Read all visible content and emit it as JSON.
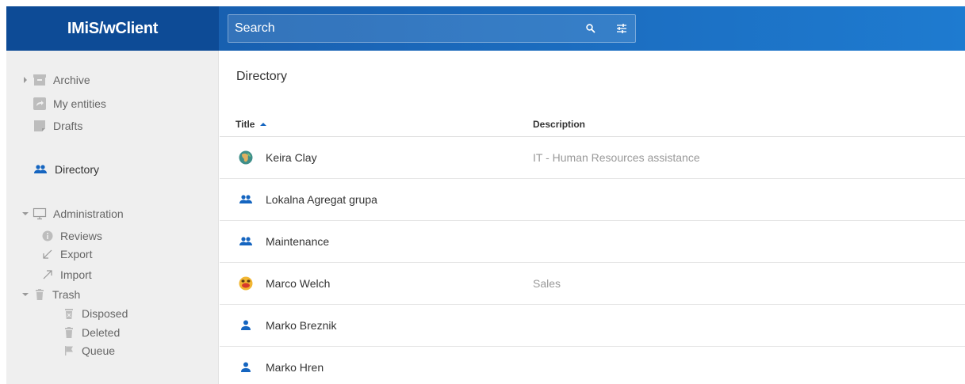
{
  "app": {
    "title": "IMiS/wClient"
  },
  "search": {
    "placeholder": "Search"
  },
  "sidebar": {
    "archive": "Archive",
    "my_entities": "My entities",
    "drafts": "Drafts",
    "directory": "Directory",
    "administration": "Administration",
    "reviews": "Reviews",
    "export": "Export",
    "import": "Import",
    "trash": "Trash",
    "disposed": "Disposed",
    "deleted": "Deleted",
    "queue": "Queue"
  },
  "main": {
    "title": "Directory",
    "columns": {
      "title": "Title",
      "description": "Description"
    },
    "rows": [
      {
        "title": "Keira Clay",
        "description": "IT - Human Resources assistance",
        "icon": "avatar-globe-icon"
      },
      {
        "title": "Lokalna Agregat grupa",
        "description": "",
        "icon": "group-icon"
      },
      {
        "title": "Maintenance",
        "description": "",
        "icon": "group-icon"
      },
      {
        "title": "Marco Welch",
        "description": "Sales",
        "icon": "avatar-emoji-icon"
      },
      {
        "title": "Marko Breznik",
        "description": "",
        "icon": "person-icon"
      },
      {
        "title": "Marko Hren",
        "description": "",
        "icon": "person-icon"
      }
    ]
  },
  "colors": {
    "brand": "#0d4b96",
    "topbar": "#1a66b8",
    "accent": "#1565c0",
    "sidebar_bg": "#efefef"
  }
}
